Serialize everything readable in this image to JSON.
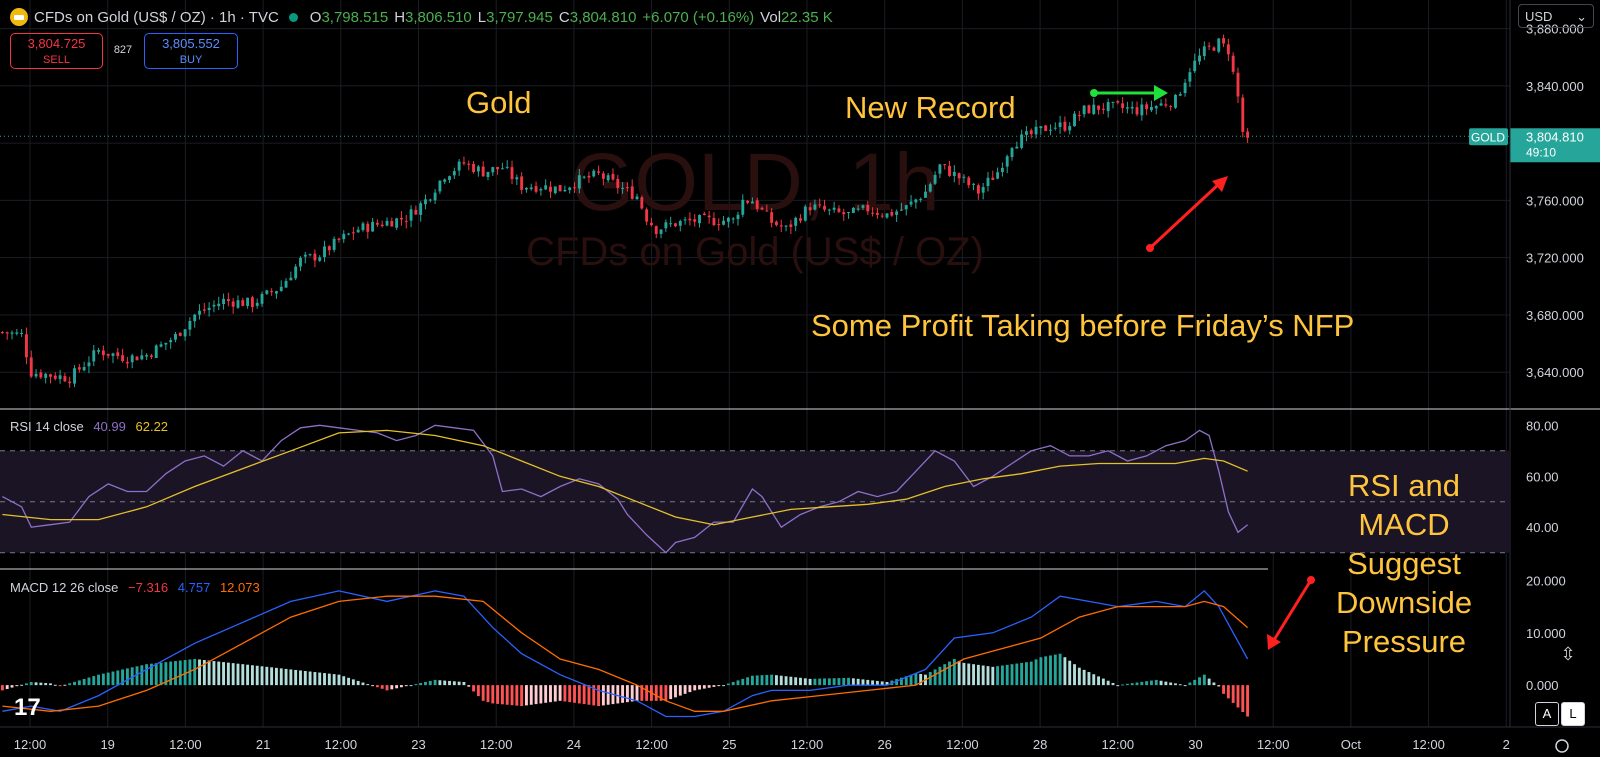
{
  "header": {
    "title": "CFDs on Gold (US$ / OZ) · 1h · TVC",
    "o_label": "O",
    "o": "3,798.515",
    "h_label": "H",
    "h": "3,806.510",
    "l_label": "L",
    "l": "3,797.945",
    "c_label": "C",
    "c": "3,804.810",
    "change": "+6.070 (+0.16%)",
    "vol_label": "Vol",
    "vol": "22.35 K"
  },
  "trade": {
    "sell_price": "3,804.725",
    "sell_label": "SELL",
    "spread": "827",
    "buy_price": "3,805.552",
    "buy_label": "BUY"
  },
  "currency": "USD",
  "watermark": {
    "symbol": "GOLD, 1h",
    "description": "CFDs on Gold (US$ / OZ)"
  },
  "annotations": {
    "gold": "Gold",
    "new_record": "New Record",
    "profit": "Some Profit Taking before Friday’s NFP",
    "rsi_macd": [
      "RSI and",
      "MACD",
      "Suggest",
      "Downside",
      "Pressure"
    ]
  },
  "rsi_legend": {
    "name": "RSI 14 close",
    "rsi": "40.99",
    "ma": "62.22"
  },
  "macd_legend": {
    "name": "MACD 12 26 close",
    "hist": "−7.316",
    "macd": "4.757",
    "signal": "12.073"
  },
  "price_tag": {
    "symbol": "GOLD",
    "price": "3,804.810",
    "countdown": "49:10"
  },
  "colors": {
    "up": "#26a69a",
    "down": "#f23645",
    "annotation": "#ffc43d",
    "rsi": "#8e6fc8",
    "rsi_ma": "#e6c029",
    "macd": "#2962ff",
    "signal": "#ff6d00"
  },
  "chart_data": {
    "type": "candlestick",
    "price_axis": {
      "range": [
        3615,
        3900
      ],
      "ticks": [
        3640,
        3680,
        3720,
        3760,
        3800,
        3840,
        3880
      ],
      "tick_labels": [
        "3,640.000",
        "3,680.000",
        "3,720.000",
        "3,760.000",
        "3,800.000",
        "3,840.000",
        "3,880.000"
      ]
    },
    "rsi_axis": {
      "range": [
        24,
        86
      ],
      "ticks": [
        40,
        60,
        80
      ],
      "tick_labels": [
        "40.00",
        "60.00",
        "80.00"
      ],
      "bands": [
        30,
        50,
        70
      ]
    },
    "macd_axis": {
      "range": [
        -8,
        22
      ],
      "ticks": [
        0,
        10,
        20
      ],
      "tick_labels": [
        "0.000",
        "10.000",
        "20.000"
      ]
    },
    "time_labels": [
      "12:00",
      "19",
      "12:00",
      "21",
      "12:00",
      "23",
      "12:00",
      "24",
      "12:00",
      "25",
      "12:00",
      "26",
      "12:00",
      "28",
      "12:00",
      "30",
      "12:00",
      "Oct",
      "12:00",
      "2"
    ],
    "close_path": [
      [
        0,
        3668
      ],
      [
        4,
        3666
      ],
      [
        6,
        3640
      ],
      [
        10,
        3638
      ],
      [
        14,
        3636
      ],
      [
        20,
        3655
      ],
      [
        26,
        3650
      ],
      [
        30,
        3652
      ],
      [
        36,
        3665
      ],
      [
        40,
        3680
      ],
      [
        46,
        3690
      ],
      [
        52,
        3688
      ],
      [
        58,
        3700
      ],
      [
        62,
        3718
      ],
      [
        66,
        3722
      ],
      [
        70,
        3732
      ],
      [
        74,
        3740
      ],
      [
        80,
        3745
      ],
      [
        84,
        3748
      ],
      [
        88,
        3760
      ],
      [
        92,
        3778
      ],
      [
        96,
        3786
      ],
      [
        100,
        3780
      ],
      [
        104,
        3783
      ],
      [
        108,
        3770
      ],
      [
        112,
        3770
      ],
      [
        116,
        3768
      ],
      [
        120,
        3774
      ],
      [
        124,
        3778
      ],
      [
        128,
        3770
      ],
      [
        132,
        3763
      ],
      [
        134,
        3748
      ],
      [
        136,
        3740
      ],
      [
        140,
        3744
      ],
      [
        144,
        3746
      ],
      [
        148,
        3746
      ],
      [
        152,
        3746
      ],
      [
        154,
        3760
      ],
      [
        156,
        3760
      ],
      [
        160,
        3745
      ],
      [
        163,
        3740
      ],
      [
        168,
        3756
      ],
      [
        172,
        3752
      ],
      [
        176,
        3750
      ],
      [
        180,
        3754
      ],
      [
        184,
        3750
      ],
      [
        188,
        3755
      ],
      [
        192,
        3766
      ],
      [
        195,
        3784
      ],
      [
        199,
        3776
      ],
      [
        203,
        3766
      ],
      [
        207,
        3780
      ],
      [
        210,
        3800
      ],
      [
        214,
        3806
      ],
      [
        218,
        3812
      ],
      [
        221,
        3812
      ],
      [
        225,
        3823
      ],
      [
        228,
        3825
      ],
      [
        232,
        3825
      ],
      [
        236,
        3823
      ],
      [
        240,
        3826
      ],
      [
        244,
        3830
      ],
      [
        247,
        3852
      ],
      [
        250,
        3864
      ],
      [
        253,
        3870
      ],
      [
        255,
        3865
      ],
      [
        257,
        3832
      ],
      [
        258,
        3808
      ],
      [
        259,
        3800
      ],
      [
        260,
        3805
      ]
    ],
    "rsi_path": [
      [
        0,
        52
      ],
      [
        4,
        48
      ],
      [
        6,
        40
      ],
      [
        10,
        41
      ],
      [
        14,
        42
      ],
      [
        18,
        52
      ],
      [
        22,
        57
      ],
      [
        26,
        54
      ],
      [
        30,
        54
      ],
      [
        34,
        61
      ],
      [
        38,
        66
      ],
      [
        42,
        68
      ],
      [
        46,
        64
      ],
      [
        50,
        70
      ],
      [
        54,
        66
      ],
      [
        58,
        74
      ],
      [
        62,
        79
      ],
      [
        66,
        80
      ],
      [
        70,
        79
      ],
      [
        74,
        78
      ],
      [
        78,
        77
      ],
      [
        82,
        74
      ],
      [
        86,
        76
      ],
      [
        90,
        80
      ],
      [
        94,
        79
      ],
      [
        98,
        78
      ],
      [
        102,
        68
      ],
      [
        104,
        54
      ],
      [
        108,
        55
      ],
      [
        112,
        52
      ],
      [
        116,
        56
      ],
      [
        120,
        59
      ],
      [
        124,
        57
      ],
      [
        128,
        51
      ],
      [
        130,
        45
      ],
      [
        134,
        37
      ],
      [
        138,
        30
      ],
      [
        140,
        34
      ],
      [
        144,
        36
      ],
      [
        148,
        42
      ],
      [
        152,
        42
      ],
      [
        156,
        55
      ],
      [
        158,
        52
      ],
      [
        162,
        40
      ],
      [
        166,
        45
      ],
      [
        170,
        48
      ],
      [
        174,
        50
      ],
      [
        178,
        54
      ],
      [
        182,
        52
      ],
      [
        186,
        54
      ],
      [
        190,
        62
      ],
      [
        194,
        70
      ],
      [
        198,
        66
      ],
      [
        202,
        56
      ],
      [
        206,
        60
      ],
      [
        210,
        65
      ],
      [
        214,
        70
      ],
      [
        218,
        72
      ],
      [
        222,
        68
      ],
      [
        226,
        68
      ],
      [
        230,
        70
      ],
      [
        234,
        66
      ],
      [
        238,
        68
      ],
      [
        242,
        72
      ],
      [
        246,
        74
      ],
      [
        249,
        78
      ],
      [
        251,
        76
      ],
      [
        253,
        62
      ],
      [
        255,
        46
      ],
      [
        257,
        38
      ],
      [
        259,
        41
      ]
    ],
    "rsi_ma_path": [
      [
        0,
        45
      ],
      [
        10,
        43
      ],
      [
        20,
        43
      ],
      [
        30,
        48
      ],
      [
        40,
        56
      ],
      [
        50,
        63
      ],
      [
        60,
        70
      ],
      [
        70,
        77
      ],
      [
        80,
        78
      ],
      [
        90,
        76
      ],
      [
        100,
        72
      ],
      [
        108,
        66
      ],
      [
        116,
        60
      ],
      [
        124,
        56
      ],
      [
        132,
        50
      ],
      [
        140,
        44
      ],
      [
        148,
        41
      ],
      [
        156,
        44
      ],
      [
        164,
        47
      ],
      [
        172,
        48
      ],
      [
        180,
        49
      ],
      [
        188,
        51
      ],
      [
        196,
        56
      ],
      [
        204,
        59
      ],
      [
        212,
        61
      ],
      [
        220,
        64
      ],
      [
        228,
        65
      ],
      [
        236,
        65
      ],
      [
        244,
        65
      ],
      [
        250,
        67
      ],
      [
        254,
        66
      ],
      [
        259,
        62
      ]
    ],
    "macd_path": [
      [
        0,
        -5
      ],
      [
        6,
        -4
      ],
      [
        12,
        -5
      ],
      [
        20,
        -2
      ],
      [
        30,
        3
      ],
      [
        40,
        8
      ],
      [
        50,
        12
      ],
      [
        60,
        16
      ],
      [
        70,
        18
      ],
      [
        80,
        16
      ],
      [
        90,
        18
      ],
      [
        96,
        17
      ],
      [
        102,
        11
      ],
      [
        108,
        6
      ],
      [
        116,
        2
      ],
      [
        124,
        -1
      ],
      [
        132,
        -3
      ],
      [
        138,
        -6
      ],
      [
        144,
        -6
      ],
      [
        150,
        -5
      ],
      [
        156,
        -2
      ],
      [
        160,
        -1
      ],
      [
        168,
        -1
      ],
      [
        176,
        0
      ],
      [
        184,
        0
      ],
      [
        192,
        3
      ],
      [
        198,
        9
      ],
      [
        206,
        10
      ],
      [
        214,
        13
      ],
      [
        220,
        17
      ],
      [
        226,
        16
      ],
      [
        232,
        15
      ],
      [
        240,
        16
      ],
      [
        246,
        15
      ],
      [
        250,
        18
      ],
      [
        253,
        15
      ],
      [
        256,
        10
      ],
      [
        259,
        5
      ]
    ],
    "signal_path": [
      [
        0,
        -4
      ],
      [
        10,
        -5
      ],
      [
        20,
        -4
      ],
      [
        30,
        -1
      ],
      [
        40,
        3
      ],
      [
        50,
        8
      ],
      [
        60,
        13
      ],
      [
        70,
        16
      ],
      [
        80,
        17
      ],
      [
        90,
        17
      ],
      [
        100,
        16
      ],
      [
        108,
        10
      ],
      [
        116,
        5
      ],
      [
        124,
        3
      ],
      [
        132,
        0
      ],
      [
        138,
        -3
      ],
      [
        144,
        -5
      ],
      [
        150,
        -5
      ],
      [
        160,
        -3
      ],
      [
        170,
        -2
      ],
      [
        180,
        -1
      ],
      [
        190,
        0
      ],
      [
        200,
        5
      ],
      [
        208,
        7
      ],
      [
        216,
        9
      ],
      [
        224,
        13
      ],
      [
        232,
        15
      ],
      [
        240,
        15
      ],
      [
        246,
        15
      ],
      [
        250,
        16
      ],
      [
        254,
        15
      ],
      [
        259,
        11
      ]
    ]
  }
}
